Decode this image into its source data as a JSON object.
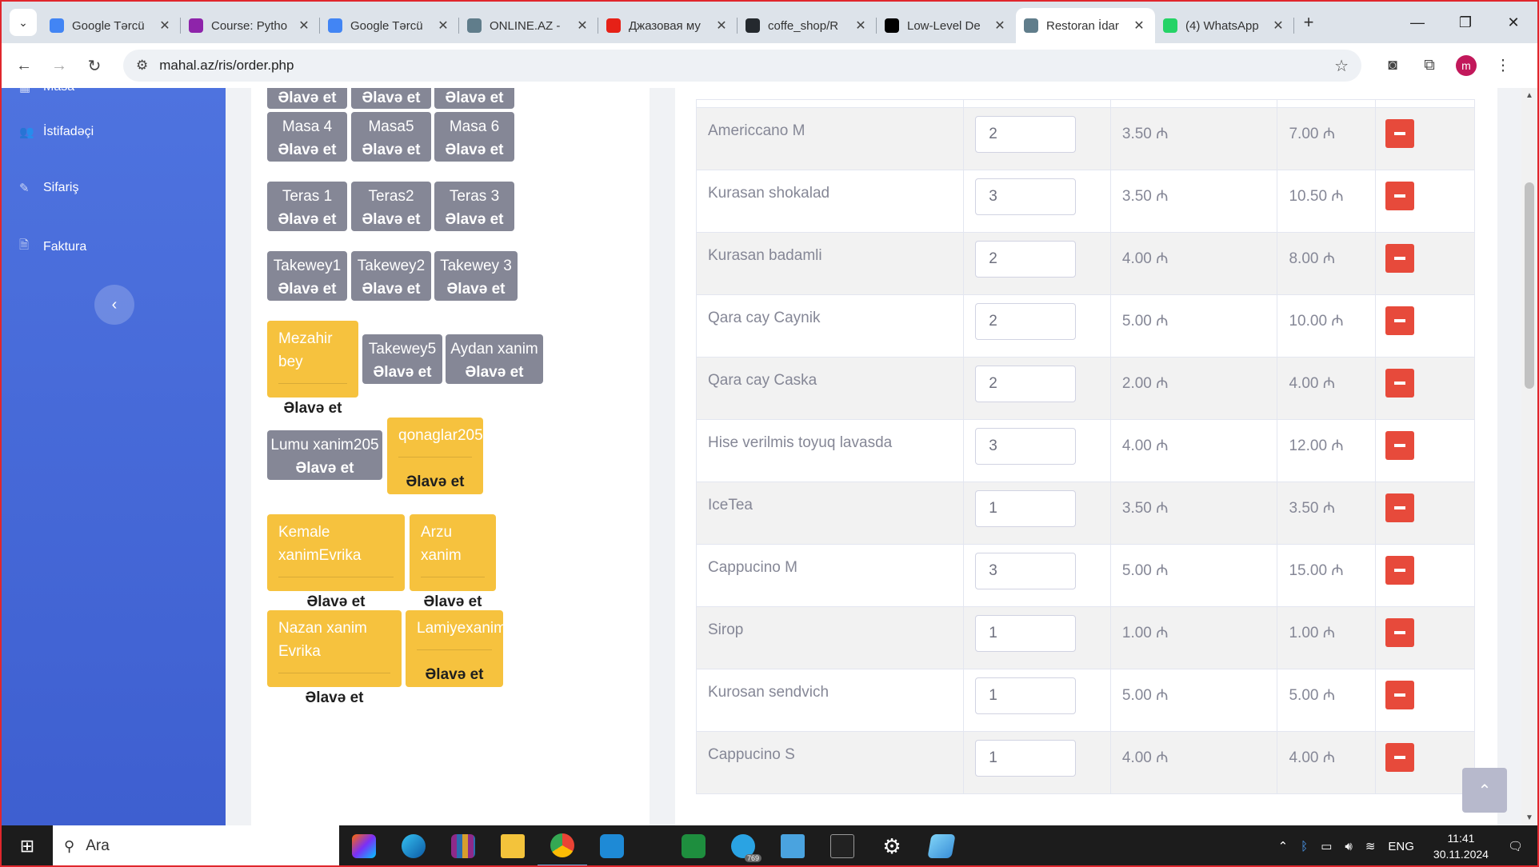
{
  "browser": {
    "tabs": [
      {
        "title": "Google Tərcü",
        "icon": "google-translate-icon",
        "color": "#4285f4"
      },
      {
        "title": "Course: Pytho",
        "icon": "course-icon",
        "color": "#8e24aa"
      },
      {
        "title": "Google Tərcü",
        "icon": "google-translate-icon",
        "color": "#4285f4"
      },
      {
        "title": "ONLINE.AZ -",
        "icon": "globe-icon",
        "color": "#607d8b"
      },
      {
        "title": "Джазовая му",
        "icon": "youtube-icon",
        "color": "#e62117"
      },
      {
        "title": "coffe_shop/R",
        "icon": "github-icon",
        "color": "#24292e"
      },
      {
        "title": "Low-Level De",
        "icon": "medium-icon",
        "color": "#000000"
      },
      {
        "title": "Restoran İdar",
        "icon": "globe-icon",
        "color": "#607d8b",
        "active": true
      },
      {
        "title": "(4) WhatsApp",
        "icon": "whatsapp-icon",
        "color": "#25d366"
      }
    ],
    "url": "mahal.az/ris/order.php",
    "avatar_letter": "m"
  },
  "sidebar": {
    "items": [
      {
        "label": "Masa",
        "icon": "table-icon"
      },
      {
        "label": "İstifadəçi",
        "icon": "users-icon"
      },
      {
        "label": "Sifariş",
        "icon": "edit-icon"
      },
      {
        "label": "Faktura",
        "icon": "file-icon"
      }
    ]
  },
  "tables": {
    "add_label": "Əlavə et",
    "buttons": [
      {
        "name": "",
        "state": "gray"
      },
      {
        "name": "",
        "state": "gray"
      },
      {
        "name": "",
        "state": "gray"
      },
      {
        "name": "Masa 4",
        "state": "gray"
      },
      {
        "name": "Masa5",
        "state": "gray"
      },
      {
        "name": "Masa 6",
        "state": "gray"
      },
      {
        "name": "Teras 1",
        "state": "gray"
      },
      {
        "name": "Teras2",
        "state": "gray"
      },
      {
        "name": "Teras 3",
        "state": "gray"
      },
      {
        "name": "Takewey1",
        "state": "gray"
      },
      {
        "name": "Takewey2",
        "state": "gray"
      },
      {
        "name": "Takewey 3",
        "state": "gray"
      },
      {
        "name": "Mezahir bey",
        "state": "occupied"
      },
      {
        "name": "Takewey5",
        "state": "gray"
      },
      {
        "name": "Aydan xanim",
        "state": "gray"
      },
      {
        "name": "Lumu xanim205",
        "state": "gray"
      },
      {
        "name": "qonaglar205",
        "state": "occupied"
      },
      {
        "name": "Kemale xanimEvrika",
        "state": "occupied"
      },
      {
        "name": "Arzu xanim",
        "state": "occupied"
      },
      {
        "name": "Nazan xanim Evrika",
        "state": "occupied"
      },
      {
        "name": "Lamiyexanim",
        "state": "occupied"
      }
    ]
  },
  "order": {
    "currency": "₼",
    "rows": [
      {
        "item": "Americcano M",
        "qty": "2",
        "price": "3.50 ₼",
        "total": "7.00 ₼"
      },
      {
        "item": "Kurasan shokalad",
        "qty": "3",
        "price": "3.50 ₼",
        "total": "10.50 ₼"
      },
      {
        "item": "Kurasan badamli",
        "qty": "2",
        "price": "4.00 ₼",
        "total": "8.00 ₼"
      },
      {
        "item": "Qara cay Caynik",
        "qty": "2",
        "price": "5.00 ₼",
        "total": "10.00 ₼"
      },
      {
        "item": "Qara cay Caska",
        "qty": "2",
        "price": "2.00 ₼",
        "total": "4.00 ₼"
      },
      {
        "item": "Hise verilmis toyuq lavasda",
        "qty": "3",
        "price": "4.00 ₼",
        "total": "12.00 ₼"
      },
      {
        "item": "IceTea",
        "qty": "1",
        "price": "3.50 ₼",
        "total": "3.50 ₼"
      },
      {
        "item": "Cappucino M",
        "qty": "3",
        "price": "5.00 ₼",
        "total": "15.00 ₼"
      },
      {
        "item": "Sirop",
        "qty": "1",
        "price": "1.00 ₼",
        "total": "1.00 ₼"
      },
      {
        "item": "Kurosan sendvich",
        "qty": "1",
        "price": "5.00 ₼",
        "total": "5.00 ₼"
      },
      {
        "item": "Cappucino S",
        "qty": "1",
        "price": "4.00 ₼",
        "total": "4.00 ₼"
      }
    ]
  },
  "taskbar": {
    "search_placeholder": "Ara",
    "language": "ENG",
    "time": "11:41",
    "date": "30.11.2024",
    "telegram_badge": "769"
  },
  "colors": {
    "primary": "#4e73df",
    "secondary": "#858796",
    "warning": "#f6c23e",
    "danger": "#e74a3b"
  }
}
